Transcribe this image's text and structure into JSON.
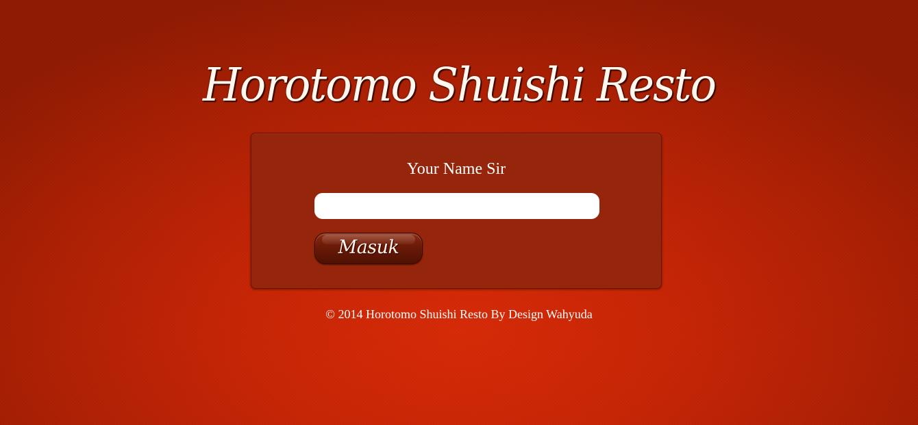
{
  "header": {
    "title": "Horotomo Shuishi Resto"
  },
  "login": {
    "label": "Your Name Sir",
    "name_input": {
      "value": "",
      "placeholder": ""
    },
    "submit_label": "Masuk"
  },
  "footer": {
    "text": "© 2014 Horotomo Shuishi Resto By Design Wahyuda"
  },
  "colors": {
    "background": "#c72405",
    "panel": "#96260b",
    "button": "#6a1a07",
    "text": "#ffffff"
  }
}
